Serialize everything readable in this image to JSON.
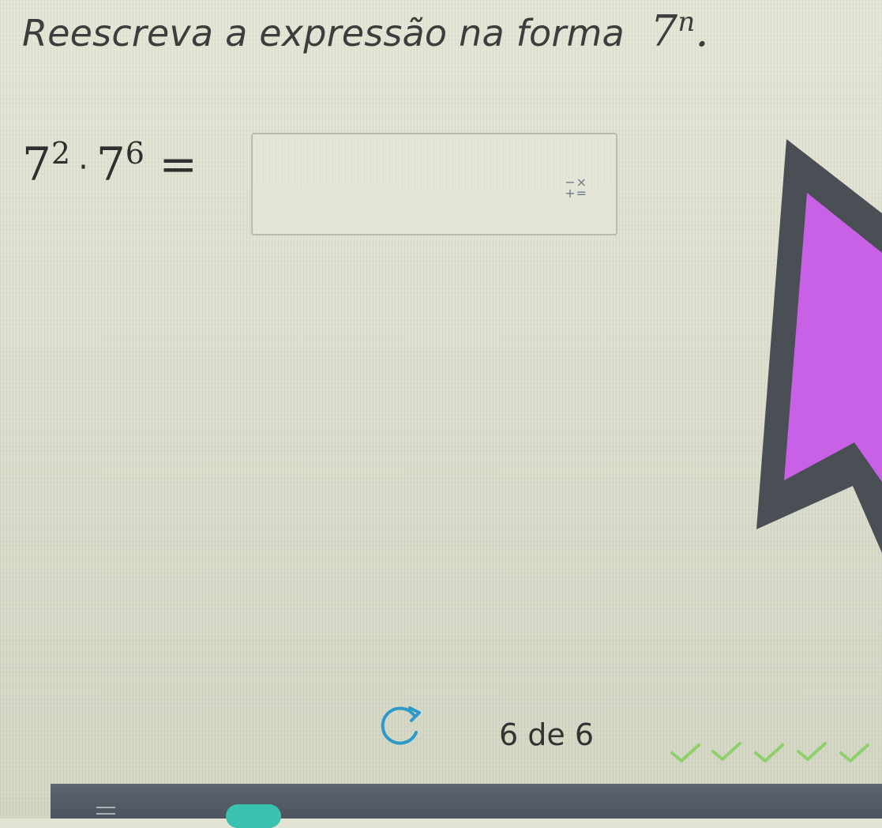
{
  "question": {
    "instruction": "Reescreva a expressão na forma",
    "form_base": "7",
    "form_exponent": "n",
    "form_end": "."
  },
  "expression": {
    "base1": "7",
    "exp1": "2",
    "operator": "·",
    "base2": "7",
    "exp2": "6",
    "equals": "="
  },
  "answer": {
    "value": "",
    "keypad_icon": "math-keypad-icon",
    "keypad_top": "−×",
    "keypad_bottom": "+="
  },
  "progress": {
    "text": "6 de 6",
    "retry_icon": "retry-icon",
    "checkmarks": 5
  },
  "colors": {
    "arrow_fill": "#c961e6",
    "arrow_outline": "#4a4f55",
    "accent": "#39c2b0"
  }
}
